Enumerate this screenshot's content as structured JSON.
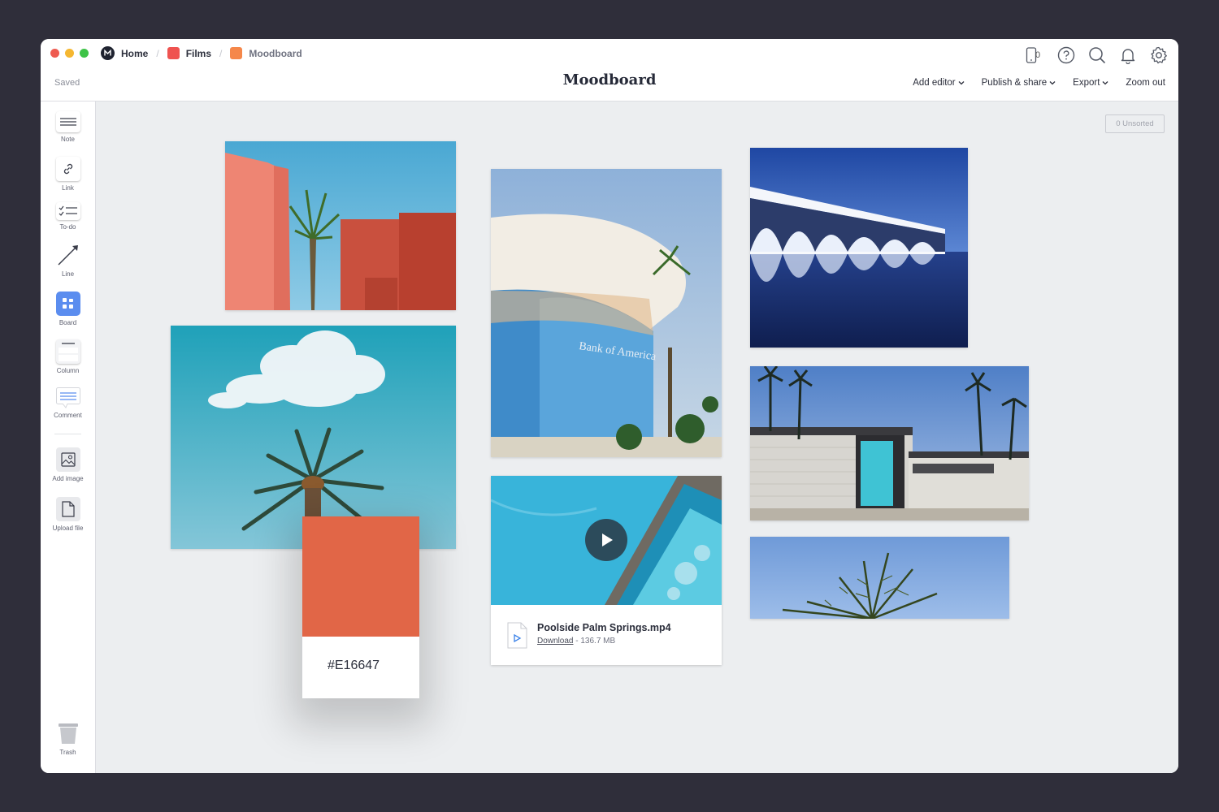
{
  "window": {
    "traffic_lights": [
      "#ee5b50",
      "#f5b731",
      "#3ec347"
    ]
  },
  "breadcrumb": [
    {
      "label": "Home",
      "icon": "milanote-logo-icon"
    },
    {
      "label": "Films",
      "icon": "board-square-icon",
      "color": "#ef5350"
    },
    {
      "label": "Moodboard",
      "icon": "board-square-icon",
      "color": "#f5874a"
    }
  ],
  "header": {
    "status": "Saved",
    "title": "Moodboard",
    "device_count": "0",
    "menu": [
      {
        "label": "Add editor",
        "dropdown": true
      },
      {
        "label": "Publish & share",
        "dropdown": true
      },
      {
        "label": "Export",
        "dropdown": true
      },
      {
        "label": "Zoom out",
        "dropdown": false
      }
    ]
  },
  "sidebar": {
    "tools": [
      {
        "label": "Note",
        "icon": "note-icon"
      },
      {
        "label": "Link",
        "icon": "link-icon"
      },
      {
        "label": "To-do",
        "icon": "todo-icon"
      },
      {
        "label": "Line",
        "icon": "line-icon"
      },
      {
        "label": "Board",
        "icon": "board-icon"
      },
      {
        "label": "Column",
        "icon": "column-icon"
      },
      {
        "label": "Comment",
        "icon": "comment-icon"
      },
      {
        "label": "Add image",
        "icon": "image-icon"
      },
      {
        "label": "Upload file",
        "icon": "file-icon"
      }
    ],
    "trash": "Trash"
  },
  "canvas": {
    "unsorted": "0 Unsorted",
    "swatch": {
      "hex": "#E16647",
      "color": "#e16647"
    },
    "video": {
      "filename": "Poolside Palm Springs.mp4",
      "download": "Download",
      "size": " - 136.7 MB"
    },
    "images": [
      "pink-walls-palm-photo",
      "cloud-palm-photo",
      "bank-building-photo",
      "palace-reflection-photo",
      "midcentury-house-photo",
      "palm-fronds-photo"
    ]
  }
}
